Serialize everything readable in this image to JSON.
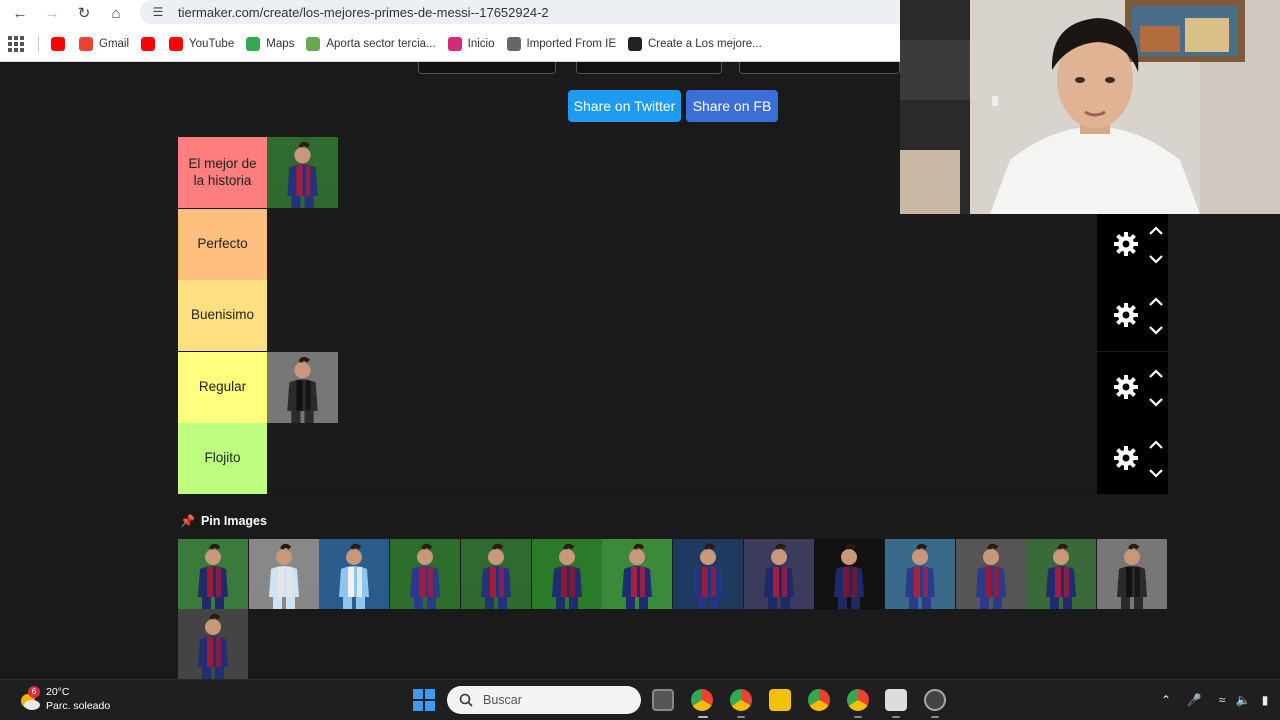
{
  "browser": {
    "url": "tiermaker.com/create/los-mejores-primes-de-messi--17652924-2",
    "bookmarks": [
      {
        "label": "",
        "icon": "youtube-icon",
        "color": "#ff0000"
      },
      {
        "label": "Gmail",
        "icon": "gmail-icon",
        "color": "#ea4335"
      },
      {
        "label": "",
        "icon": "youtube-icon",
        "color": "#ff0000"
      },
      {
        "label": "YouTube",
        "icon": "youtube-icon",
        "color": "#ff0000"
      },
      {
        "label": "Maps",
        "icon": "maps-icon",
        "color": "#34a853"
      },
      {
        "label": "Aporta sector tercia...",
        "icon": "site-icon",
        "color": "#6aa84f"
      },
      {
        "label": "Inicio",
        "icon": "instagram-icon",
        "color": "#d62976"
      },
      {
        "label": "Imported From IE",
        "icon": "folder-icon",
        "color": "#666666"
      },
      {
        "label": "Create a Los mejore...",
        "icon": "tiermaker-icon",
        "color": "#222222"
      }
    ]
  },
  "share": {
    "twitter_label": "Share on Twitter",
    "fb_label": "Share on FB",
    "twitter_color": "#1d9bf0",
    "fb_color": "#3b6fd6"
  },
  "tiers": [
    {
      "label": "El mejor de la historia",
      "color": "#ff7f7f",
      "items": 1
    },
    {
      "label": "Perfecto",
      "color": "#ffbf7f",
      "items": 0
    },
    {
      "label": "Buenisimo",
      "color": "#ffdf7f",
      "items": 0
    },
    {
      "label": "Regular",
      "color": "#ffff7f",
      "items": 1
    },
    {
      "label": "Flojito",
      "color": "#bfff7f",
      "items": 0
    }
  ],
  "pool": {
    "title": "Pin Images",
    "count": 15
  },
  "taskbar": {
    "temp": "20°C",
    "weather": "Parc. soleado",
    "badge": "6",
    "search_placeholder": "Buscar"
  }
}
